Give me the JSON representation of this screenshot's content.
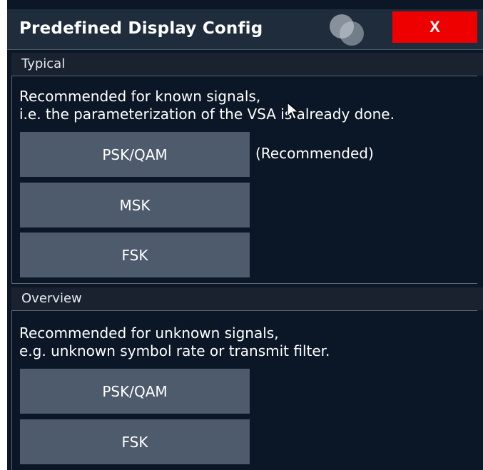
{
  "dialog": {
    "title": "Predefined Display Config",
    "close_label": "X"
  },
  "typical": {
    "label": "Typical",
    "description_line1": "Recommended for known signals,",
    "description_line2": "i.e. the parameterization of the VSA is already done.",
    "buttons": [
      {
        "label": "PSK/QAM"
      },
      {
        "label": "MSK"
      },
      {
        "label": "FSK"
      }
    ],
    "recommended_note": "(Recommended)"
  },
  "overview": {
    "label": "Overview",
    "description_line1": "Recommended for unknown signals,",
    "description_line2": "e.g. unknown symbol rate or transmit filter.",
    "buttons": [
      {
        "label": "PSK/QAM"
      },
      {
        "label": "FSK"
      }
    ]
  },
  "colors": {
    "background": "#0b1726",
    "titlebar": "#1f2c3c",
    "button": "#4d5b6c",
    "close": "#ee0000"
  }
}
